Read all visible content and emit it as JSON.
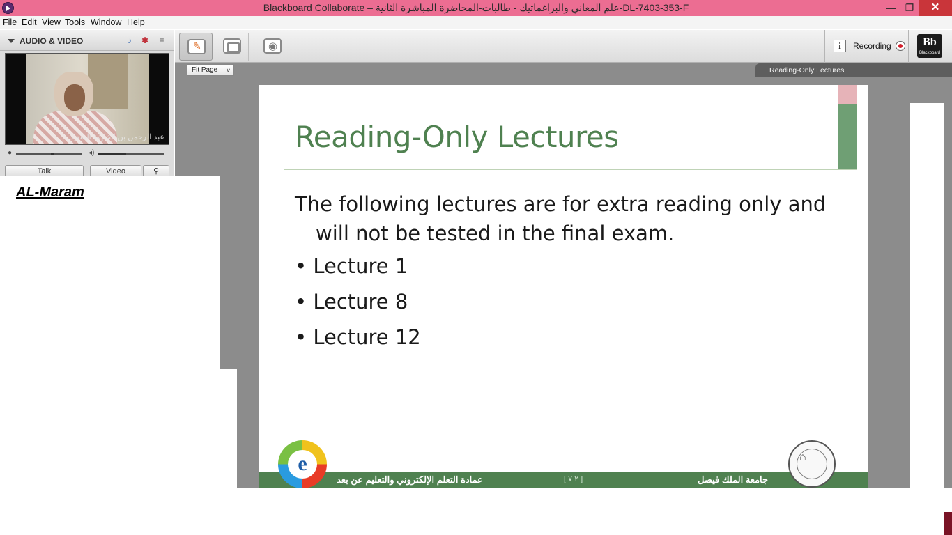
{
  "window": {
    "title": "Blackboard Collaborate – علم المعاني والبراغماتيك - طالبات-المحاضرة المباشرة الثانية-DL-7403-353-F",
    "minimize": "—",
    "maximize": "❐",
    "close": "✕"
  },
  "menu": [
    "File",
    "Edit",
    "View",
    "Tools",
    "Window",
    "Help"
  ],
  "audio_video": {
    "title": "AUDIO & VIDEO",
    "video_caption": "عبد الرحمن بن الخليفة السعيد",
    "talk_label": "Talk",
    "video_label": "Video"
  },
  "note": {
    "label": "AL-Maram"
  },
  "toolbar": {
    "recording_label": "Recording",
    "info_label": "i",
    "logo_text": "Bb",
    "logo_sub": "Blackboard"
  },
  "view": {
    "zoom_option": "Fit Page",
    "slide_tab_title": "Reading-Only Lectures"
  },
  "slide": {
    "title": "Reading-Only Lectures",
    "intro_line1": "The following lectures are for extra reading only and",
    "intro_line2": "will not be tested in the final exam.",
    "bullets": [
      "• Lecture 1",
      "• Lecture 8",
      "• Lecture 12"
    ],
    "footer_left": "عمادة التعلم الإلكتروني والتعليم عن بعد",
    "footer_right": "جامعة الملك فيصل",
    "footer_page": "[ ٢ ٧ ]",
    "logo_letter": "e"
  },
  "colors": {
    "titlebar": "#ec6d92",
    "slide_green": "#4f8150",
    "accent_pink": "#e6b3b8",
    "record_red": "#d21e2b"
  }
}
